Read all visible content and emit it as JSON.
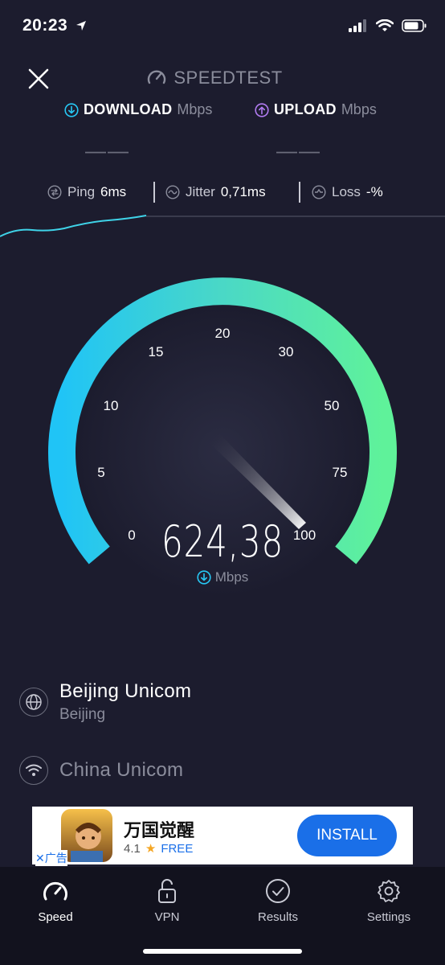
{
  "status_bar": {
    "time": "20:23"
  },
  "header": {
    "brand": "SPEEDTEST"
  },
  "metrics": {
    "download": {
      "name": "DOWNLOAD",
      "unit": "Mbps",
      "value": "——"
    },
    "upload": {
      "name": "UPLOAD",
      "unit": "Mbps",
      "value": "——"
    }
  },
  "stats": {
    "ping": {
      "label": "Ping",
      "value": "6ms"
    },
    "jitter": {
      "label": "Jitter",
      "value": "0,71ms"
    },
    "loss": {
      "label": "Loss",
      "value": "-%"
    }
  },
  "gauge": {
    "labels": [
      "0",
      "5",
      "10",
      "15",
      "20",
      "30",
      "50",
      "75",
      "100"
    ],
    "value": "624,38",
    "unit": "Mbps"
  },
  "server": {
    "name": "Beijing Unicom",
    "location": "Beijing"
  },
  "provider": {
    "name": "China Unicom"
  },
  "ad": {
    "title": "万国觉醒",
    "rating": "4.1",
    "price": "FREE",
    "install_label": "INSTALL",
    "badge": "广告"
  },
  "tabs": [
    {
      "label": "Speed"
    },
    {
      "label": "VPN"
    },
    {
      "label": "Results"
    },
    {
      "label": "Settings"
    }
  ],
  "colors": {
    "background": "#1c1c2e",
    "accent_cyan": "#27c8f5",
    "accent_green": "#5ff29a",
    "upload_purple": "#b27cf2"
  }
}
